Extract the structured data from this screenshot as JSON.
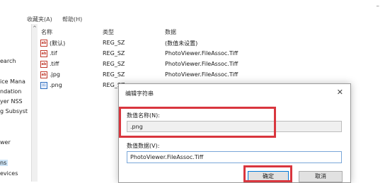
{
  "menu": {
    "items": [
      "",
      "收藏夹(A)",
      "帮助(H)"
    ],
    "min_glyph": "–"
  },
  "tree": {
    "items": [
      "",
      "",
      "",
      "earch",
      "",
      "ice Mana",
      "ndation",
      "yer NSS",
      "g Subsyst",
      "",
      "",
      "wer",
      "",
      "ns",
      "evices"
    ],
    "selected_index": 13,
    "scroll_glyph": "^"
  },
  "list": {
    "headers": {
      "name": "名称",
      "type": "类型",
      "data": "数据"
    },
    "rows": [
      {
        "icon": "string-value-icon",
        "name": "(默认)",
        "type": "REG_SZ",
        "data": "(数值未设置)"
      },
      {
        "icon": "string-value-icon",
        "name": ".tif",
        "type": "REG_SZ",
        "data": "PhotoViewer.FileAssoc.Tiff"
      },
      {
        "icon": "string-value-icon",
        "name": ".tiff",
        "type": "REG_SZ",
        "data": "PhotoViewer.FileAssoc.Tiff"
      },
      {
        "icon": "string-value-icon",
        "name": ".jpg",
        "type": "REG_SZ",
        "data": "PhotoViewer.FileAssoc.Tiff"
      },
      {
        "icon": "binary-value-icon",
        "name": ".png",
        "type": "REG_SZ",
        "data": ""
      }
    ]
  },
  "dialog": {
    "title": "编辑字符串",
    "close_glyph": "✕",
    "name_label": "数值名称(N):",
    "name_value": ".png",
    "data_label": "数值数据(V):",
    "data_value": "PhotoViewer.FileAssoc.Tiff",
    "ok_label": "确定",
    "cancel_label": "取消"
  },
  "colors": {
    "highlight": "#d9363e",
    "selection": "#cce4f7",
    "accent": "#0078d7"
  }
}
